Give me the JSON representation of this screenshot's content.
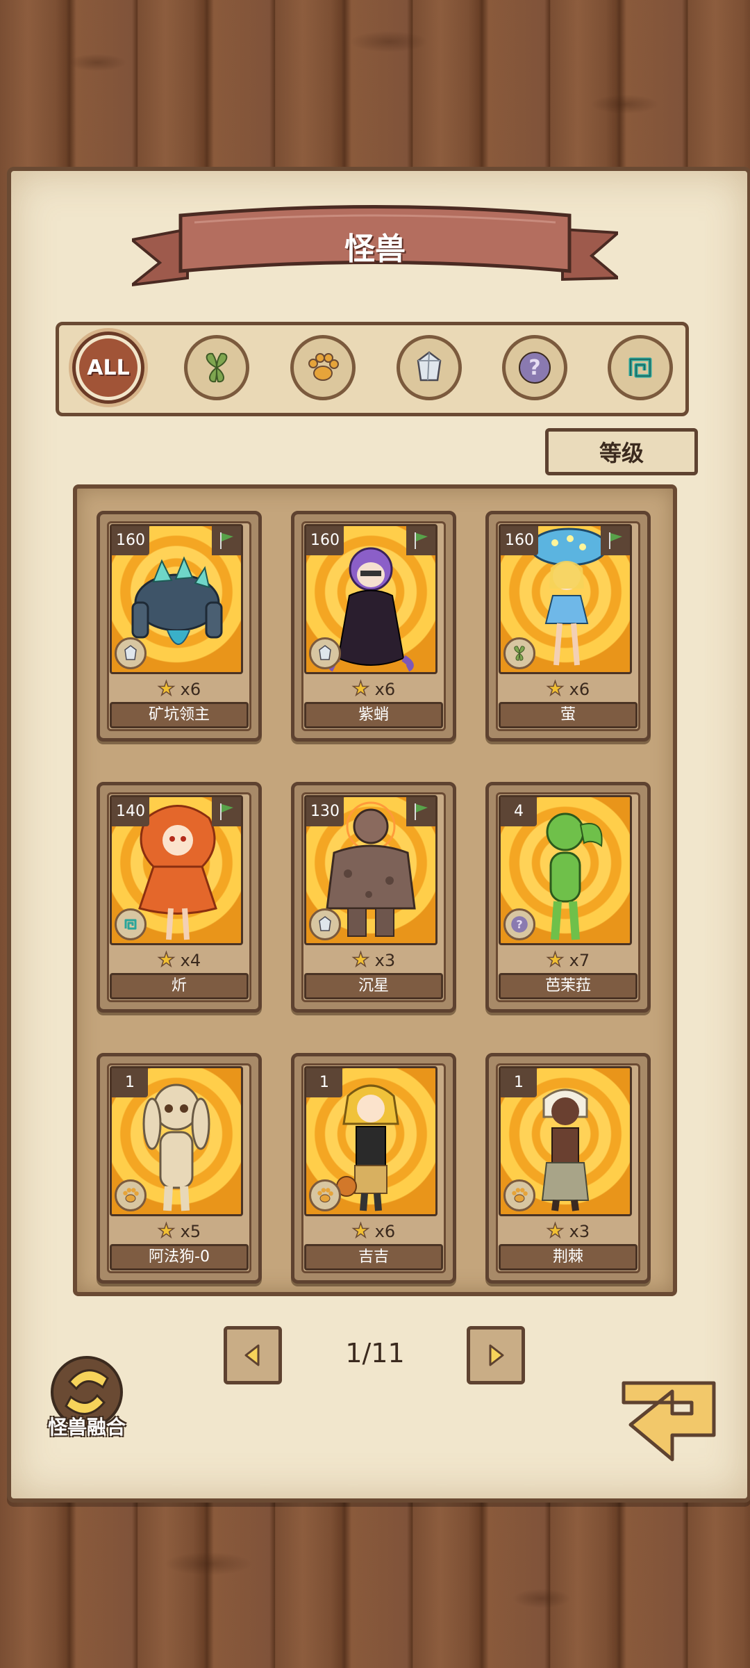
{
  "header": {
    "title": "怪兽"
  },
  "filters": [
    {
      "icon": "all-filter",
      "label": "ALL",
      "active": true
    },
    {
      "icon": "leaf-icon",
      "active": false
    },
    {
      "icon": "paw-icon",
      "active": false
    },
    {
      "icon": "crystal-icon",
      "active": false
    },
    {
      "icon": "question-icon",
      "active": false
    },
    {
      "icon": "spiral-icon",
      "active": false
    }
  ],
  "sort": {
    "label": "等级"
  },
  "monsters": [
    {
      "level": "160",
      "stars": "x6",
      "name": "矿坑领主",
      "type_icon": "crystal-icon",
      "flag": true
    },
    {
      "level": "160",
      "stars": "x6",
      "name": "紫蛸",
      "type_icon": "crystal-icon",
      "flag": true
    },
    {
      "level": "160",
      "stars": "x6",
      "name": "萤",
      "type_icon": "leaf-icon",
      "flag": true
    },
    {
      "level": "140",
      "stars": "x4",
      "name": "炘",
      "type_icon": "spiral-icon",
      "flag": true
    },
    {
      "level": "130",
      "stars": "x3",
      "name": "沉星",
      "type_icon": "crystal-icon",
      "flag": true
    },
    {
      "level": "4",
      "stars": "x7",
      "name": "芭茉菈",
      "type_icon": "question-icon",
      "flag": false
    },
    {
      "level": "1",
      "stars": "x5",
      "name": "阿法狗-0",
      "type_icon": "paw-icon",
      "flag": false
    },
    {
      "level": "1",
      "stars": "x6",
      "name": "吉吉",
      "type_icon": "paw-icon",
      "flag": false
    },
    {
      "level": "1",
      "stars": "x3",
      "name": "荆棘",
      "type_icon": "paw-icon",
      "flag": false
    }
  ],
  "pager": {
    "current": "1/11"
  },
  "fusion": {
    "label": "怪兽融合"
  },
  "colors": {
    "banner": "#b46e5f",
    "paper": "#f1e6cc",
    "wood": "#7a4e33",
    "card_bg": "#ffd257"
  }
}
